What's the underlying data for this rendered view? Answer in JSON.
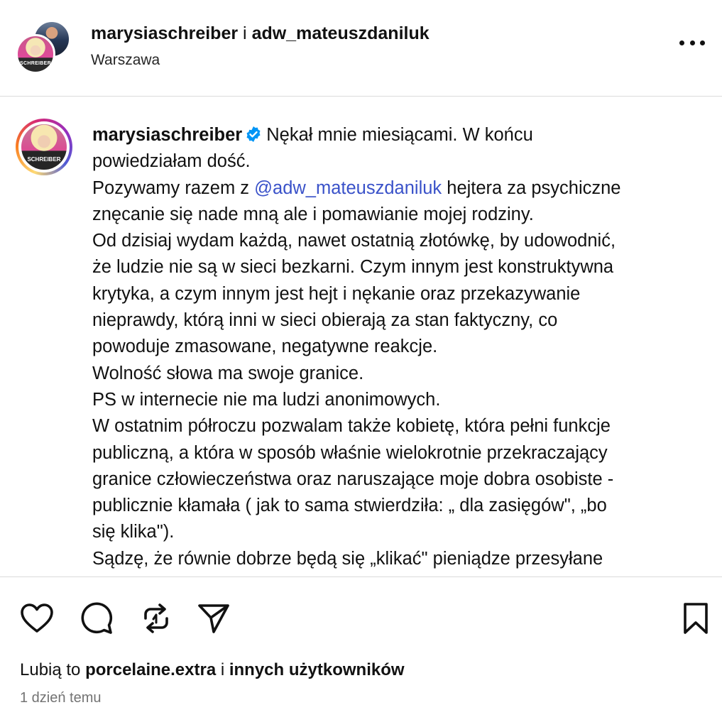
{
  "header": {
    "user1": "marysiaschreiber",
    "separator": "i",
    "user2": "adw_mateuszdaniluk",
    "location": "Warszawa",
    "avatar_brand": "SCHREIBER",
    "more_icon": "more-horizontal-icon"
  },
  "caption": {
    "username": "marysiaschreiber",
    "avatar_brand": "SCHREIBER",
    "verified_color": "#0095f6",
    "mention_color": "#3a52c9",
    "lines": {
      "l1": "Nękał mnie miesiącami. W końcu",
      "l2": "powiedziałam dość.",
      "l3_pre": "Pozywamy razem z ",
      "l3_mention": "@adw_mateuszdaniluk",
      "l3_post": " hejtera za psychiczne",
      "l4": "znęcanie się nade mną ale i pomawianie mojej rodziny.",
      "l5": "Od dzisiaj wydam każdą, nawet ostatnią złotówkę, by udowodnić,",
      "l6": "że ludzie nie są w sieci bezkarni. Czym innym jest konstruktywna",
      "l7": "krytyka, a czym innym jest hejt i nękanie oraz przekazywanie",
      "l8": "nieprawdy, którą inni w sieci obierają za stan faktyczny, co",
      "l9": "powoduje zmasowane, negatywne reakcje.",
      "l10": "Wolność słowa ma swoje granice.",
      "l11": "PS w internecie nie ma ludzi anonimowych.",
      "l12": "W ostatnim półroczu pozwalam także kobietę, która pełni funkcje",
      "l13": "publiczną, a która w sposób właśnie wielokrotnie przekraczający",
      "l14": "granice człowieczeństwa oraz naruszające moje dobra osobiste -",
      "l15": "publicznie kłamała ( jak to sama stwierdziła: „ dla zasięgów\", „bo",
      "l16": "się klika\").",
      "l17": "Sądzę, że równie dobrze będą się „klikać\" pieniądze przesyłane"
    }
  },
  "actions": {
    "like": "heart-icon",
    "comment": "comment-icon",
    "repost": "repost-icon",
    "share": "send-icon",
    "save": "bookmark-icon"
  },
  "likes": {
    "prefix": "Lubią to ",
    "user": "porcelaine.extra",
    "middle": " i ",
    "others": "innych użytkowników"
  },
  "timestamp": "1 dzień temu"
}
